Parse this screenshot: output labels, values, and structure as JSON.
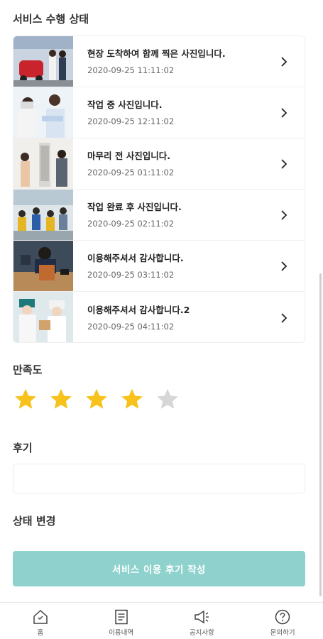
{
  "service_status": {
    "title": "서비스 수행 상태",
    "items": [
      {
        "title": "현장 도착하여 함께 찍은 사진입니다.",
        "date": "2020-09-25 11:11:02"
      },
      {
        "title": "작업 중 사진입니다.",
        "date": "2020-09-25 12:11:02"
      },
      {
        "title": "마무리 전 사진입니다.",
        "date": "2020-09-25 01:11:02"
      },
      {
        "title": "작업 완료 후 사진입니다.",
        "date": "2020-09-25 02:11:02"
      },
      {
        "title": "이용해주셔서 감사합니다.",
        "date": "2020-09-25 03:11:02"
      },
      {
        "title": "이용해주셔서 감사합니다.2",
        "date": "2020-09-25 04:11:02"
      }
    ]
  },
  "satisfaction": {
    "title": "만족도",
    "rating": 4,
    "max": 5,
    "filled_color": "#f7c21b",
    "empty_color": "#d6d6d6"
  },
  "review": {
    "title": "후기",
    "value": "",
    "placeholder": ""
  },
  "status_change": {
    "title": "상태 변경"
  },
  "submit_button": {
    "label": "서비스 이용 후기 작성",
    "color": "#8fd2cd"
  },
  "bottom_nav": {
    "items": [
      {
        "label": "홈",
        "icon": "home-icon"
      },
      {
        "label": "이용내역",
        "icon": "document-list-icon"
      },
      {
        "label": "공지사항",
        "icon": "megaphone-icon"
      },
      {
        "label": "문의하기",
        "icon": "question-circle-icon"
      }
    ]
  }
}
